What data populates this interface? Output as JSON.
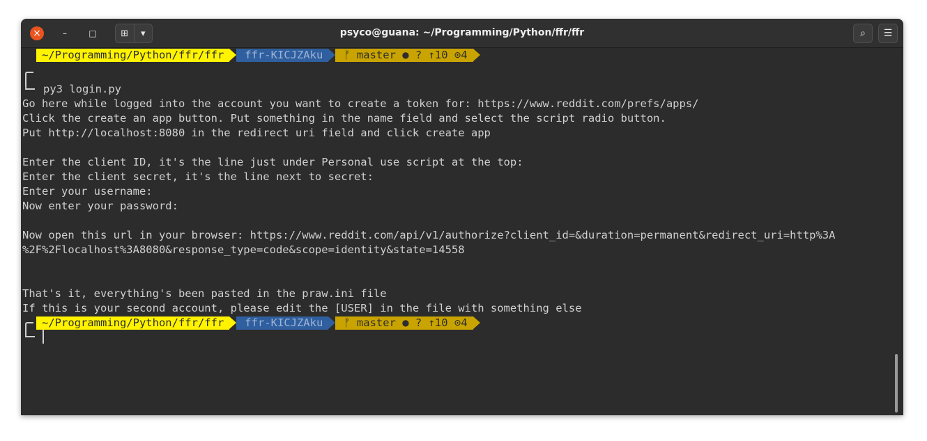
{
  "window": {
    "title": "psyco@guana: ~/Programming/Python/ffr/ffr"
  },
  "titlebar": {
    "close_icon": "×",
    "minimize_icon": "–",
    "maximize_icon": "□",
    "newtab_icon": "⊞",
    "tabmenu_icon": "▾",
    "search_icon": "⌕",
    "menu_icon": "☰"
  },
  "prompt": {
    "path": "~/Programming/Python/ffr/ffr",
    "env": "ffr-KICJZAku",
    "git": "ᚠ master ● ? ↑10 ⊙4"
  },
  "terminal": {
    "command": "py3 login.py",
    "lines": [
      "Go here while logged into the account you want to create a token for: https://www.reddit.com/prefs/apps/",
      "Click the create an app button. Put something in the name field and select the script radio button.",
      "Put http://localhost:8080 in the redirect uri field and click create app",
      "",
      "Enter the client ID, it's the line just under Personal use script at the top:",
      "Enter the client secret, it's the line next to secret:",
      "Enter your username:",
      "Now enter your password:",
      "",
      "Now open this url in your browser: https://www.reddit.com/api/v1/authorize?client_id=&duration=permanent&redirect_uri=http%3A",
      "%2F%2Flocalhost%3A8080&response_type=code&scope=identity&state=14558",
      "",
      "",
      "That's it, everything's been pasted in the praw.ini file",
      "If this is your second account, please edit the [USER] in the file with something else"
    ]
  }
}
